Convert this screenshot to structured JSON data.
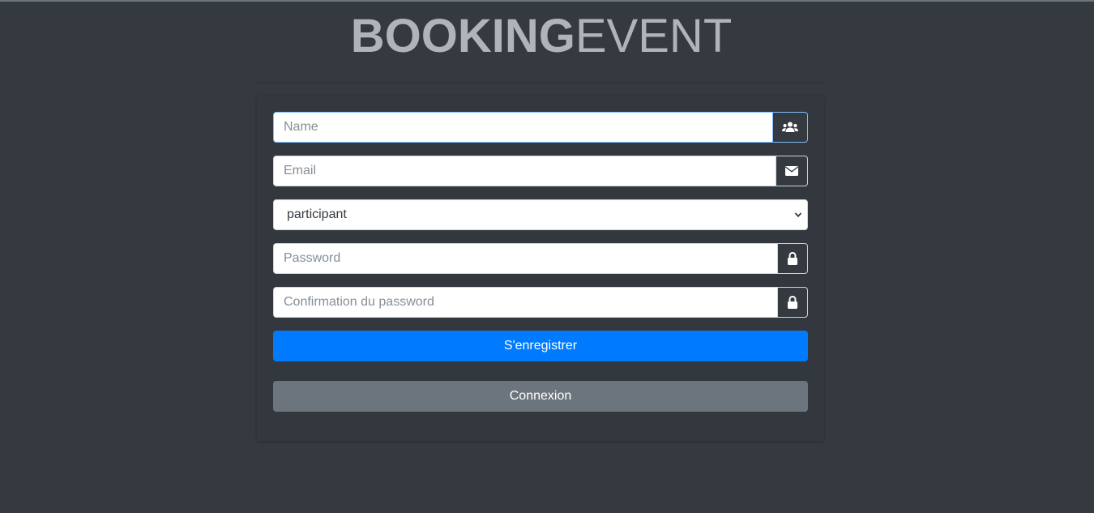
{
  "logo": {
    "bold": "BOOKING",
    "light": "EVENT"
  },
  "form": {
    "name": {
      "placeholder": "Name",
      "icon": "users-icon"
    },
    "email": {
      "placeholder": "Email",
      "icon": "envelope-icon"
    },
    "role": {
      "selected": "participant"
    },
    "password": {
      "placeholder": "Password",
      "icon": "lock-icon"
    },
    "password_confirm": {
      "placeholder": "Confirmation du password",
      "icon": "lock-icon"
    },
    "register_label": "S'enregistrer",
    "login_label": "Connexion"
  },
  "colors": {
    "background": "#343a40",
    "primary": "#007bff",
    "secondary": "#6c757d",
    "focus_border": "#80bdff"
  }
}
